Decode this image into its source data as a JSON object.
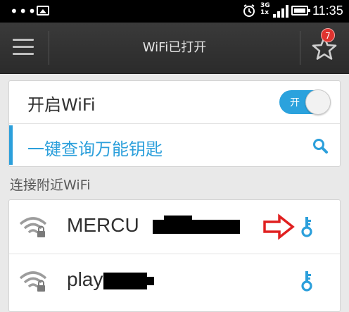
{
  "statusbar": {
    "time": "11:35",
    "network": "3G",
    "network_sub": "1x",
    "icons": [
      "notification-dots",
      "image-icon",
      "alarm-icon",
      "signal-icon",
      "battery-icon"
    ]
  },
  "toolbar": {
    "title": "WiFi已打开",
    "badge_count": "7",
    "icons": [
      "menu-icon",
      "star-icon"
    ]
  },
  "wifi_toggle": {
    "label": "开启WiFi",
    "switch_text": "开",
    "state": "on"
  },
  "master_key": {
    "label": "一键查询万能钥匙",
    "icon": "search-icon"
  },
  "nearby_section": {
    "title": "连接附近WiFi"
  },
  "networks": [
    {
      "ssid": "MERCU",
      "locked": true,
      "has_key": true,
      "icons": [
        "wifi-locked-icon",
        "key-icon"
      ]
    },
    {
      "ssid": "play",
      "locked": true,
      "has_key": true,
      "icons": [
        "wifi-locked-icon",
        "key-icon"
      ]
    }
  ],
  "colors": {
    "accent": "#2b9fdb",
    "toolbar": "#333333",
    "badge": "#e0332f",
    "arrow": "#e02020"
  }
}
